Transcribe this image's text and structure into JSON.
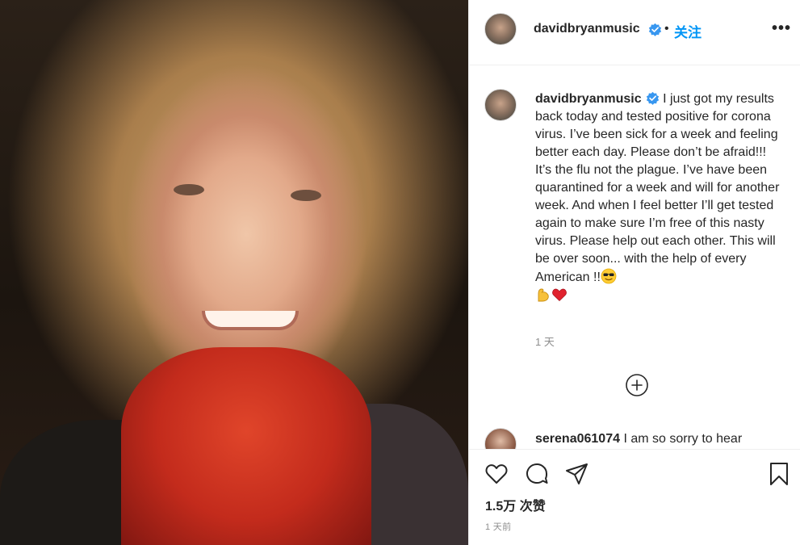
{
  "post": {
    "username": "davidbryanmusic",
    "follow_label": "关注",
    "separator": "•",
    "more": "•••",
    "caption_text": "I just got my results back today and tested positive for corona virus. I’ve been sick for a week and feeling better each day. Please don’t be afraid!!! It’s the flu not the plague. I’ve have been quarantined for a week and will for another week. And when I feel better I’ll get tested again to make sure I’m free of this nasty virus. Please help out each other. This will be over soon... with the help of every American !!",
    "caption_time": "1 天",
    "likes": "1.5万 次赞",
    "post_time": "1 天前"
  },
  "comment": {
    "username": "serena061074",
    "text": "I am so sorry to hear"
  },
  "icons": {
    "verified": "verified-badge-icon",
    "more": "more-options-icon",
    "load_more": "add-circle-icon",
    "like": "heart-icon",
    "comment": "comment-icon",
    "share": "paper-plane-icon",
    "save": "bookmark-icon",
    "emoji_1": "sunglasses-emoji",
    "emoji_2": "flexed-biceps-emoji",
    "emoji_3": "red-heart-emoji"
  },
  "colors": {
    "accent": "#0095f6",
    "verified": "#3897f0",
    "text": "#262626",
    "muted": "#8e8e8e",
    "border": "#efefef"
  }
}
